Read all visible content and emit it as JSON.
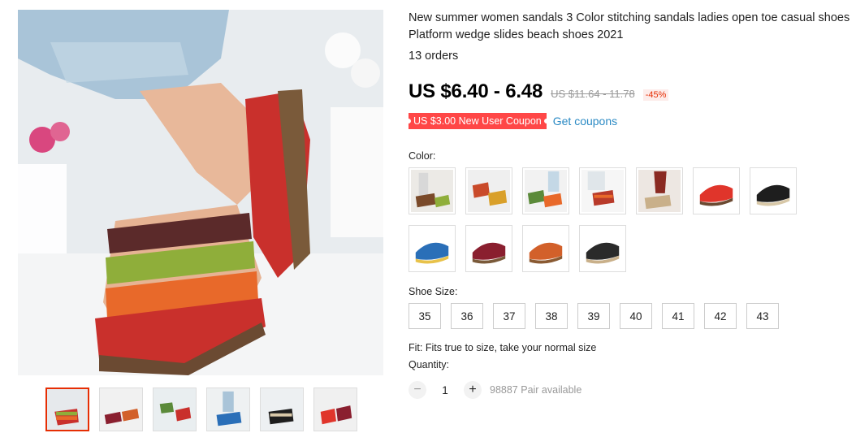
{
  "product": {
    "title": "New summer women sandals 3 Color stitching sandals ladies open toe casual shoes Platform wedge slides beach shoes 2021",
    "orders": "13 orders",
    "price": "US $6.40 - 6.48",
    "old_price": "US $11.64 - 11.78",
    "discount": "-45%"
  },
  "coupon": {
    "label": "US $3.00 New User Coupon",
    "link": "Get coupons"
  },
  "color": {
    "label": "Color:",
    "options": [
      {
        "icon": "photo-sandal-multicolor-icon",
        "accent": "#7a4a2a"
      },
      {
        "icon": "photo-sandal-multicolor-icon",
        "accent": "#c94a2a"
      },
      {
        "icon": "photo-sandal-multicolor-icon",
        "accent": "#5b8a3a"
      },
      {
        "icon": "photo-sandal-multicolor-icon",
        "accent": "#b83a2a"
      },
      {
        "icon": "photo-sandal-multicolor-icon",
        "accent": "#8a2a22"
      },
      {
        "icon": "sandal-red-icon",
        "accent": "#e0352b"
      },
      {
        "icon": "sandal-black-icon",
        "accent": "#1e1e1e"
      },
      {
        "icon": "sandal-blue-icon",
        "accent": "#2a6fb8"
      },
      {
        "icon": "sandal-burgundy-icon",
        "accent": "#8a1f2f"
      },
      {
        "icon": "sandal-orange-icon",
        "accent": "#d2602a"
      },
      {
        "icon": "sandal-black-icon",
        "accent": "#2a2a2a"
      }
    ]
  },
  "size": {
    "label": "Shoe Size:",
    "options": [
      "35",
      "36",
      "37",
      "38",
      "39",
      "40",
      "41",
      "42",
      "43"
    ]
  },
  "fit": "Fit: Fits true to size, take your normal size",
  "quantity": {
    "label": "Quantity:",
    "value": "1",
    "minus": "−",
    "plus": "+",
    "available": "98887 Pair available"
  },
  "gallery": {
    "thumbnails": 6,
    "selected_index": 0
  }
}
